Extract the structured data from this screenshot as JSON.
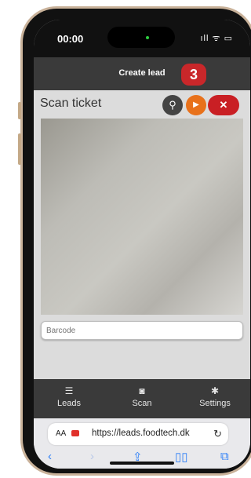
{
  "status_bar": {
    "time": "00:00",
    "icons": "ıll ᯤ ▭"
  },
  "header": {
    "title": "Create lead",
    "badge": "3"
  },
  "scan": {
    "title": "Scan ticket",
    "search_icon": "⚲",
    "play_icon": "▶",
    "close_icon": "✕",
    "barcode_placeholder": "Barcode"
  },
  "nav": {
    "items": [
      {
        "icon": "☰",
        "label": "Leads"
      },
      {
        "icon": "◙",
        "label": "Scan"
      },
      {
        "icon": "✱",
        "label": "Settings"
      }
    ]
  },
  "safari": {
    "aa": "AA",
    "url": "https://leads.foodtech.dk",
    "reload": "↻",
    "back": "‹",
    "forward": "›",
    "share": "⇪",
    "bookmarks": "▯▯",
    "tabs": "⧉"
  },
  "colors": {
    "accent_red": "#c9272a",
    "accent_orange": "#e8711b",
    "header": "#3a3a3a",
    "ios_blue": "#2c7ef7"
  }
}
